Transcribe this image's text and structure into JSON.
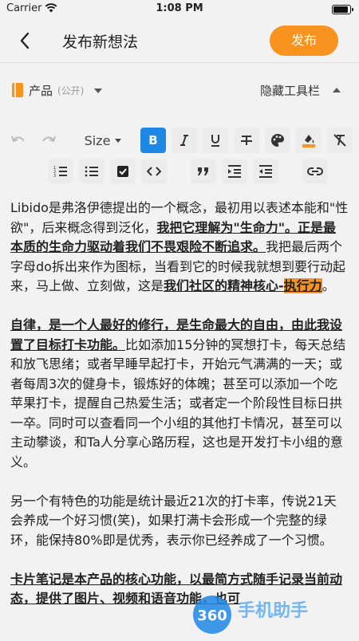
{
  "status_bar": {
    "carrier": "Carrier",
    "time": "1:08 PM",
    "battery_level": 0.95
  },
  "navbar": {
    "title": "发布新想法",
    "publish_label": "发布"
  },
  "meta": {
    "category": "产品",
    "visibility": "(公开)",
    "hide_toolbar_label": "隐藏工具栏"
  },
  "toolbar": {
    "size_label": "Size",
    "bold_label": "B",
    "buttons": [
      "undo-icon",
      "redo-icon",
      "size",
      "bold-icon",
      "italic-icon",
      "underline-icon",
      "strikethrough-icon",
      "palette-icon",
      "text-color-icon",
      "clear-format-icon",
      "ordered-list-icon",
      "bullet-list-icon",
      "checkbox-icon",
      "code-icon",
      "quote-icon",
      "indent-icon",
      "outdent-icon",
      "link-icon"
    ]
  },
  "content": {
    "p1": [
      "Libido是弗洛伊德提出的一个概念，最初用以表述本能和\"性欲\"，后来概念得到泛化，",
      "我把它理解为\"生命力\"。正是最本质的生命力驱动着我们不畏艰险不断追求。",
      "我把最后两个字母do拆出来作为图标，当看到它的时候我就想到要行动起来，马上做、立刻做，这是",
      "我们社区的精神核心-",
      "执行力",
      "。"
    ],
    "p2": [
      "自律，是一个人最好的修行，是生命最大的自由，由此我设置了目标打卡功能。",
      "比如添加15分钟的冥想打卡，每天总结和放飞思绪；或者早睡早起打卡，开始元气满满的一天；或者每周3次的健身卡，锻炼好的体魄；甚至可以添加一个吃苹果打卡，提醒自己热爱生活；或者定一个阶段性目标日拱一卒。同时可以查看同一个小组的其他打卡情况，甚至可以主动攀谈，和Ta人分享心路历程，这也是开发打卡小组的意义。"
    ],
    "p3": [
      "另一个有特色的功能是统计最近21次的打卡率，传说21天会养成一个好习惯(笑)，如果打满卡会形成一个完整的绿环，能保持80%即是优秀，表示你已经养成了一个习惯。"
    ],
    "p4": [
      "卡片笔记是本产品的核心功能，",
      "以最简方式随手记录当前动态，提供了图片、视频和语音功能，也可"
    ]
  },
  "watermark": {
    "logo": "360",
    "text": "手机助手"
  },
  "colors": {
    "accent": "#f7931e",
    "active": "#1e88e5",
    "background": "#f2f2f2"
  }
}
